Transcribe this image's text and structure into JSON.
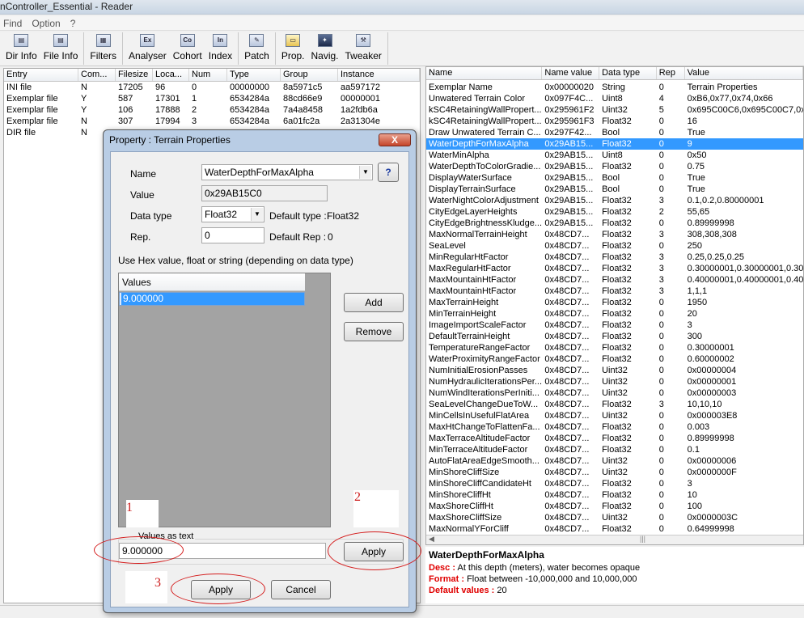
{
  "window": {
    "title": "nController_Essential - Reader"
  },
  "menu": [
    "Find",
    "Option",
    "?"
  ],
  "toolbar": [
    {
      "label": "Dir Info",
      "icon": "dir-info-icon"
    },
    {
      "label": "File Info",
      "icon": "file-info-icon"
    },
    {
      "label": "Filters",
      "icon": "filters-icon"
    },
    {
      "label": "Analyser",
      "icon": "analyser-icon"
    },
    {
      "label": "Cohort",
      "icon": "cohort-icon"
    },
    {
      "label": "Index",
      "icon": "index-icon"
    },
    {
      "label": "Patch",
      "icon": "patch-icon"
    },
    {
      "label": "Prop.",
      "icon": "prop-icon"
    },
    {
      "label": "Navig.",
      "icon": "navig-icon"
    },
    {
      "label": "Tweaker",
      "icon": "tweaker-icon"
    }
  ],
  "entries": {
    "columns": [
      "Entry",
      "Com...",
      "Filesize",
      "Loca...",
      "Num",
      "Type",
      "Group",
      "Instance"
    ],
    "rows": [
      [
        "INI file",
        "N",
        "17205",
        "96",
        "0",
        "00000000",
        "8a5971c5",
        "aa597172"
      ],
      [
        "Exemplar file",
        "Y",
        "587",
        "17301",
        "1",
        "6534284a",
        "88cd66e9",
        "00000001"
      ],
      [
        "Exemplar file",
        "Y",
        "106",
        "17888",
        "2",
        "6534284a",
        "7a4a8458",
        "1a2fdb6a"
      ],
      [
        "Exemplar file",
        "N",
        "307",
        "17994",
        "3",
        "6534284a",
        "6a01fc2a",
        "2a31304e"
      ],
      [
        "DIR file",
        "N",
        "",
        "",
        "",
        "",
        "",
        ""
      ]
    ]
  },
  "properties": {
    "columns": [
      "Name",
      "Name value",
      "Data type",
      "Rep",
      "Value"
    ],
    "rows": [
      [
        "Exemplar Name",
        "0x00000020",
        "String",
        "0",
        "Terrain Properties"
      ],
      [
        "Unwatered Terrain Color",
        "0x097F4C...",
        "Uint8",
        "4",
        "0xB6,0x77,0x74,0x66"
      ],
      [
        "kSC4RetainingWallPropert...",
        "0x295961F2",
        "Uint32",
        "5",
        "0x695C00C6,0x695C00C7,0x6"
      ],
      [
        "kSC4RetainingWallPropert...",
        "0x295961F3",
        "Float32",
        "0",
        "16"
      ],
      [
        "Draw Unwatered Terrain C...",
        "0x297F42...",
        "Bool",
        "0",
        "True"
      ],
      [
        "WaterDepthForMaxAlpha",
        "0x29AB15...",
        "Float32",
        "0",
        "9"
      ],
      [
        "WaterMinAlpha",
        "0x29AB15...",
        "Uint8",
        "0",
        "0x50"
      ],
      [
        "WaterDepthToColorGradie...",
        "0x29AB15...",
        "Float32",
        "0",
        "0.75"
      ],
      [
        "DisplayWaterSurface",
        "0x29AB15...",
        "Bool",
        "0",
        "True"
      ],
      [
        "DisplayTerrainSurface",
        "0x29AB15...",
        "Bool",
        "0",
        "True"
      ],
      [
        "WaterNightColorAdjustment",
        "0x29AB15...",
        "Float32",
        "3",
        "0.1,0.2,0.80000001"
      ],
      [
        "CityEdgeLayerHeights",
        "0x29AB15...",
        "Float32",
        "2",
        "55,65"
      ],
      [
        "CityEdgeBrightnessKludge...",
        "0x29AB15...",
        "Float32",
        "0",
        "0.89999998"
      ],
      [
        "MaxNormalTerrainHeight",
        "0x48CD7...",
        "Float32",
        "3",
        "308,308,308"
      ],
      [
        "SeaLevel",
        "0x48CD7...",
        "Float32",
        "0",
        "250"
      ],
      [
        "MinRegularHtFactor",
        "0x48CD7...",
        "Float32",
        "3",
        "0.25,0.25,0.25"
      ],
      [
        "MaxRegularHtFactor",
        "0x48CD7...",
        "Float32",
        "3",
        "0.30000001,0.30000001,0.30"
      ],
      [
        "MaxMountainHtFactor",
        "0x48CD7...",
        "Float32",
        "3",
        "0.40000001,0.40000001,0.40"
      ],
      [
        "MaxMountainHtFactor",
        "0x48CD7...",
        "Float32",
        "3",
        "1,1,1"
      ],
      [
        "MaxTerrainHeight",
        "0x48CD7...",
        "Float32",
        "0",
        "1950"
      ],
      [
        "MinTerrainHeight",
        "0x48CD7...",
        "Float32",
        "0",
        "20"
      ],
      [
        "ImageImportScaleFactor",
        "0x48CD7...",
        "Float32",
        "0",
        "3"
      ],
      [
        "DefaultTerrainHeight",
        "0x48CD7...",
        "Float32",
        "0",
        "300"
      ],
      [
        "TemperatureRangeFactor",
        "0x48CD7...",
        "Float32",
        "0",
        "0.30000001"
      ],
      [
        "WaterProximityRangeFactor",
        "0x48CD7...",
        "Float32",
        "0",
        "0.60000002"
      ],
      [
        "NumInitialErosionPasses",
        "0x48CD7...",
        "Uint32",
        "0",
        "0x00000004"
      ],
      [
        "NumHydraulicIterationsPer...",
        "0x48CD7...",
        "Uint32",
        "0",
        "0x00000001"
      ],
      [
        "NumWindIterationsPerIniti...",
        "0x48CD7...",
        "Uint32",
        "0",
        "0x00000003"
      ],
      [
        "SeaLevelChangeDueToW...",
        "0x48CD7...",
        "Float32",
        "3",
        "10,10,10"
      ],
      [
        "MinCellsInUsefulFlatArea",
        "0x48CD7...",
        "Uint32",
        "0",
        "0x000003E8"
      ],
      [
        "MaxHtChangeToFlattenFa...",
        "0x48CD7...",
        "Float32",
        "0",
        "0.003"
      ],
      [
        "MaxTerraceAltitudeFactor",
        "0x48CD7...",
        "Float32",
        "0",
        "0.89999998"
      ],
      [
        "MinTerraceAltitudeFactor",
        "0x48CD7...",
        "Float32",
        "0",
        "0.1"
      ],
      [
        "AutoFlatAreaEdgeSmooth...",
        "0x48CD7...",
        "Uint32",
        "0",
        "0x00000006"
      ],
      [
        "MinShoreCliffSize",
        "0x48CD7...",
        "Uint32",
        "0",
        "0x0000000F"
      ],
      [
        "MinShoreCliffCandidateHt",
        "0x48CD7...",
        "Float32",
        "0",
        "3"
      ],
      [
        "MinShoreCliffHt",
        "0x48CD7...",
        "Float32",
        "0",
        "10"
      ],
      [
        "MaxShoreCliffHt",
        "0x48CD7...",
        "Float32",
        "0",
        "100"
      ],
      [
        "MaxShoreCliffSize",
        "0x48CD7...",
        "Uint32",
        "0",
        "0x0000003C"
      ],
      [
        "MaxNormalYForCliff",
        "0x48CD7...",
        "Float32",
        "0",
        "0.64999998"
      ]
    ]
  },
  "description": {
    "title": "WaterDepthForMaxAlpha",
    "desc_label": "Desc :",
    "desc": "At this depth (meters), water becomes opaque",
    "format_label": "Format :",
    "format": "Float between -10,000,000 and 10,000,000",
    "default_label": "Default values :",
    "default": "20"
  },
  "dialog": {
    "title": "Property : Terrain Properties",
    "close": "X",
    "name_label": "Name",
    "name_value": "WaterDepthForMaxAlpha",
    "help": "?",
    "value_label": "Value",
    "value_value": "0x29AB15C0",
    "datatype_label": "Data type",
    "datatype_value": "Float32",
    "default_type_label": "Default type :",
    "default_type_value": "Float32",
    "rep_label": "Rep.",
    "rep_value": "0",
    "default_rep_label": "Default Rep :",
    "default_rep_value": "0",
    "hint": "Use Hex value, float or string (depending on data type)",
    "values_header": "Values",
    "values": [
      "9.000000"
    ],
    "add": "Add",
    "remove": "Remove",
    "values_as_text_label": "Values as text",
    "values_as_text": "9.000000",
    "apply_text": "Apply",
    "apply": "Apply",
    "cancel": "Cancel"
  },
  "annotations": {
    "n1": "1",
    "n2": "2",
    "n3": "3"
  },
  "colors": {
    "selection": "#3399ff",
    "annotation": "#d41c1c",
    "desc_label": "#e00000"
  }
}
